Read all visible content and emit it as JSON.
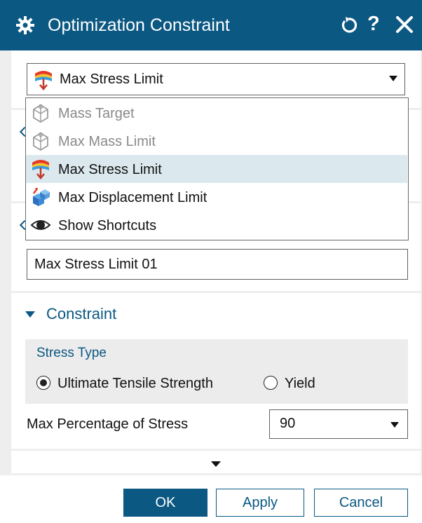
{
  "dialog": {
    "title": "Optimization Constraint",
    "help_label": "?",
    "icons": {
      "settings": "gear-icon",
      "reset": "reset-icon",
      "close": "close-icon"
    }
  },
  "constraint_type": {
    "selected": "Max Stress Limit",
    "options": [
      {
        "label": "Mass Target",
        "enabled": false,
        "icon": "mass-icon"
      },
      {
        "label": "Max Mass Limit",
        "enabled": false,
        "icon": "mass-icon"
      },
      {
        "label": "Max Stress Limit",
        "enabled": true,
        "icon": "stress-icon",
        "selected": true
      },
      {
        "label": "Max Displacement Limit",
        "enabled": true,
        "icon": "displacement-icon"
      },
      {
        "label": "Show Shortcuts",
        "enabled": true,
        "icon": "eye-icon"
      }
    ]
  },
  "name_field": {
    "value": "Max Stress Limit 01"
  },
  "constraint_section": {
    "title": "Constraint",
    "stress_type": {
      "title": "Stress Type",
      "options": [
        {
          "label": "Ultimate Tensile Strength",
          "selected": true
        },
        {
          "label": "Yield",
          "selected": false
        }
      ]
    },
    "max_percentage": {
      "label": "Max Percentage of Stress",
      "value": "90"
    }
  },
  "buttons": {
    "ok": "OK",
    "apply": "Apply",
    "cancel": "Cancel"
  },
  "colors": {
    "accent": "#0b5882",
    "selected_row": "#dbe9ee",
    "disabled_text": "#8a8a8a"
  }
}
